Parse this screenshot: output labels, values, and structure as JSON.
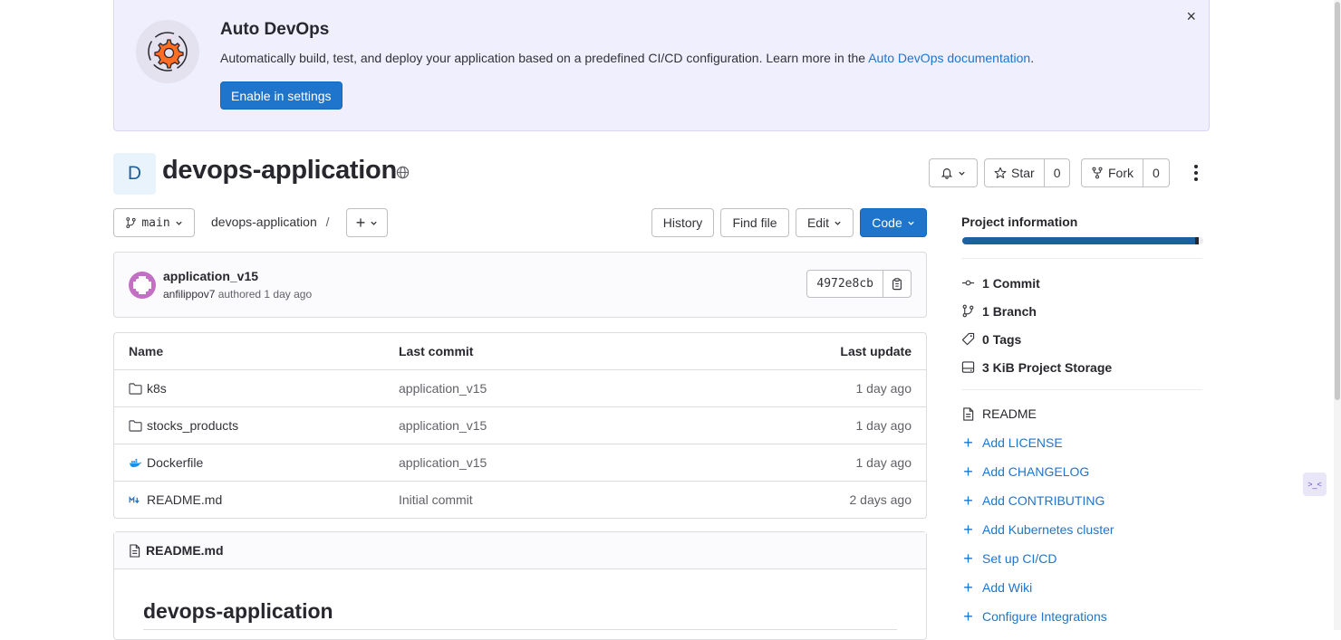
{
  "banner": {
    "title": "Auto DevOps",
    "text": "Automatically build, test, and deploy your application based on a predefined CI/CD configuration. Learn more in the ",
    "link": "Auto DevOps documentation",
    "link_suffix": ".",
    "button": "Enable in settings",
    "close": "×",
    "accent": "#1f75cb"
  },
  "project": {
    "avatar_letter": "D",
    "name": "devops-application",
    "star_label": "Star",
    "star_count": "0",
    "fork_label": "Fork",
    "fork_count": "0"
  },
  "toolbar": {
    "branch": "main",
    "path": "devops-application",
    "path_sep": "/",
    "add_label": "+",
    "history": "History",
    "find_file": "Find file",
    "edit": "Edit",
    "code": "Code"
  },
  "commit": {
    "title": "application_v15",
    "author": "anfilippov7",
    "meta": " authored 1 day ago",
    "sha": "4972e8cb"
  },
  "table": {
    "headers": [
      "Name",
      "Last commit",
      "Last update"
    ],
    "rows": [
      {
        "name": "k8s",
        "icon": "folder-icon",
        "commit": "application_v15",
        "date": "1 day ago"
      },
      {
        "name": "stocks_products",
        "icon": "folder-icon",
        "commit": "application_v15",
        "date": "1 day ago"
      },
      {
        "name": "Dockerfile",
        "icon": "docker-icon",
        "commit": "application_v15",
        "date": "1 day ago"
      },
      {
        "name": "README.md",
        "icon": "markdown-icon",
        "commit": "Initial commit",
        "date": "2 days ago"
      }
    ]
  },
  "readme": {
    "filename": "README.md",
    "heading": "devops-application"
  },
  "sidebar": {
    "title": "Project information",
    "progress": 0.98,
    "stats": [
      {
        "icon": "commit-icon",
        "count": "1",
        "label": "Commit"
      },
      {
        "icon": "branch-icon",
        "count": "1",
        "label": "Branch"
      },
      {
        "icon": "tag-icon",
        "count": "0",
        "label": "Tags"
      },
      {
        "icon": "storage-icon",
        "count": "3 KiB",
        "label": "Project Storage"
      }
    ],
    "readme_link": "README",
    "links": [
      "Add LICENSE",
      "Add CHANGELOG",
      "Add CONTRIBUTING",
      "Add Kubernetes cluster",
      "Set up CI/CD",
      "Add Wiki",
      "Configure Integrations"
    ]
  },
  "widget": {
    "label": ">_<"
  }
}
